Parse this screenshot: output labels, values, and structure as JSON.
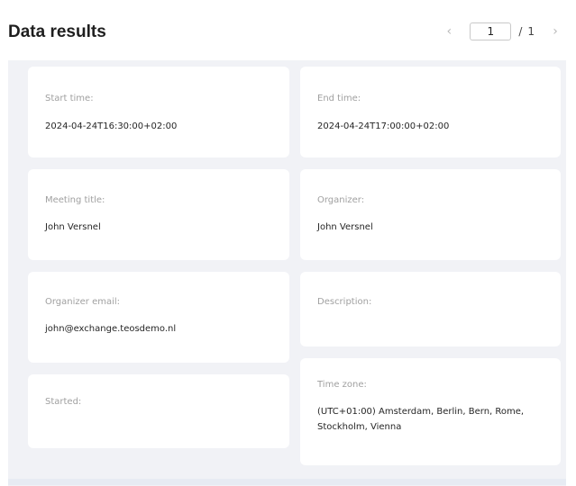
{
  "header": {
    "title": "Data results",
    "pager": {
      "current_page": "1",
      "separator": "/",
      "total_pages": "1",
      "prev_icon": "chevron-left-icon",
      "next_icon": "chevron-right-icon"
    }
  },
  "fields": {
    "start_time": {
      "label": "Start time:",
      "value": "2024-04-24T16:30:00+02:00"
    },
    "end_time": {
      "label": "End time:",
      "value": "2024-04-24T17:00:00+02:00"
    },
    "meeting_title": {
      "label": "Meeting title:",
      "value": "John Versnel"
    },
    "organizer": {
      "label": "Organizer:",
      "value": "John Versnel"
    },
    "organizer_email": {
      "label": "Organizer email:",
      "value": "john@exchange.teosdemo.nl"
    },
    "description": {
      "label": "Description:",
      "value": ""
    },
    "started": {
      "label": "Started:",
      "value": ""
    },
    "time_zone": {
      "label": "Time zone:",
      "value": "(UTC+01:00) Amsterdam, Berlin, Bern, Rome, Stockholm, Vienna"
    }
  },
  "colors": {
    "panel_background": "#f1f2f6",
    "card_background": "#ffffff",
    "label_text": "#a0a0a0",
    "value_text": "#262626"
  }
}
